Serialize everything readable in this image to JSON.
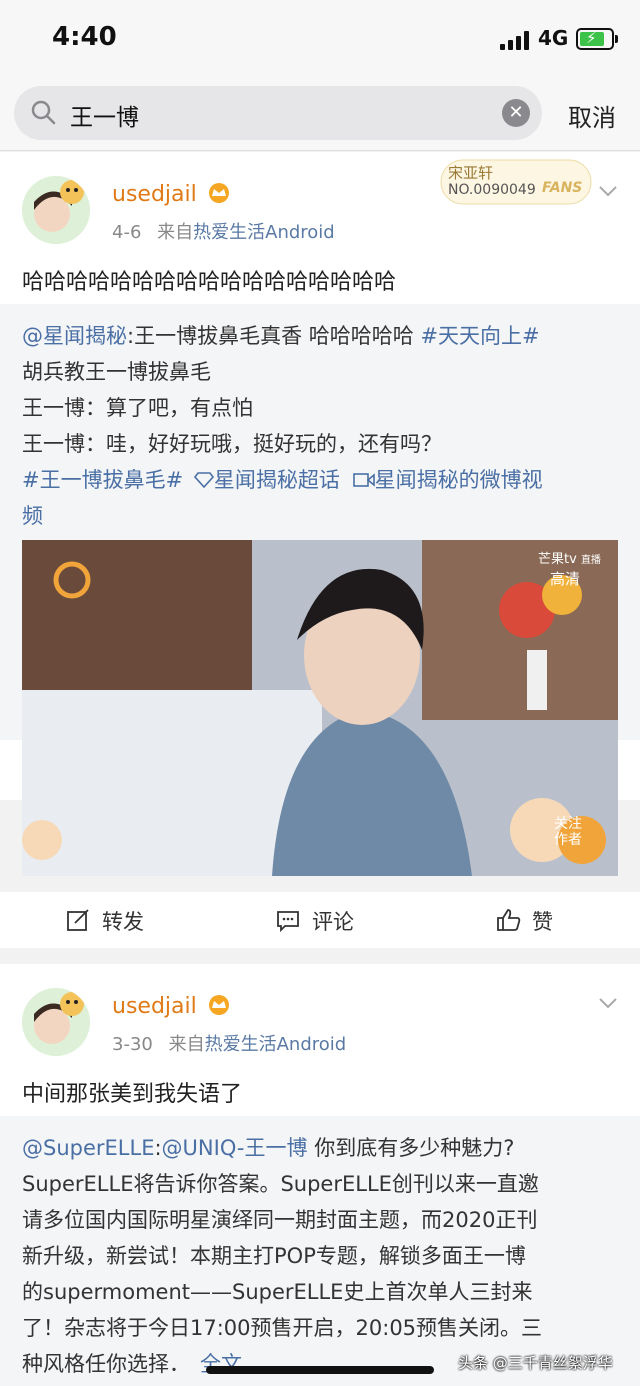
{
  "status_bar": {
    "time": "4:40",
    "network": "4G"
  },
  "search": {
    "query": "王一博",
    "cancel_label": "取消"
  },
  "posts": [
    {
      "username": "usedjail",
      "date": "4-6",
      "source_prefix": "来自",
      "source_name": "热爱生活Android",
      "fan_badge": {
        "name": "宋亚轩",
        "number": "NO.0090049",
        "label": "FANS"
      },
      "text": "哈哈哈哈哈哈哈哈哈哈哈哈哈哈哈哈哈",
      "repost": {
        "author": "@星闻揭秘",
        "line1_text": ":王一博拔鼻毛真香 哈哈哈哈哈 ",
        "line1_tag": "#天天向上#",
        "line2": "胡兵教王一博拔鼻毛",
        "line3": "王一博：算了吧，有点怕",
        "line4": "王一博：哇，好好玩哦，挺好玩的，还有吗？",
        "tag2": "#王一博拔鼻毛#",
        "supertopic": "星闻揭秘超话",
        "video_link_a": "星闻揭秘的微博视",
        "video_link_b": "频",
        "video": {
          "channel": "芒果tv",
          "live": "直播",
          "quality": "高清",
          "follow_label_a": "关注",
          "follow_label_b": "作者"
        }
      },
      "actions": {
        "repost": "转发",
        "comment": "评论",
        "like": "赞"
      }
    },
    {
      "username": "usedjail",
      "date": "3-30",
      "source_prefix": "来自",
      "source_name": "热爱生活Android",
      "text": "中间那张美到我失语了",
      "repost": {
        "lines": [
          "@SuperELLE:@UNIQ-王一博 你到底有多少种魅力?",
          "SuperELLE将告诉你答案。SuperELLE创刊以来一直邀",
          "请多位国内国际明星演绎同一期封面主题，而2020正刊",
          "新升级，新尝试！本期主打POP专题，解锁多面王一博",
          "的supermoment——SuperELLE史上首次单人三封来",
          "了！杂志将于今日17:00预售开启，20:05预售关闭。三",
          "种风格任你选择．"
        ],
        "link_author_a": "@SuperELLE",
        "link_author_b": "@UNIQ-王一博",
        "line1_rest": " 你到底有多少种魅力?",
        "full_text_label": "全文"
      }
    }
  ],
  "watermark": "头条 @三千青丝絮浮华"
}
